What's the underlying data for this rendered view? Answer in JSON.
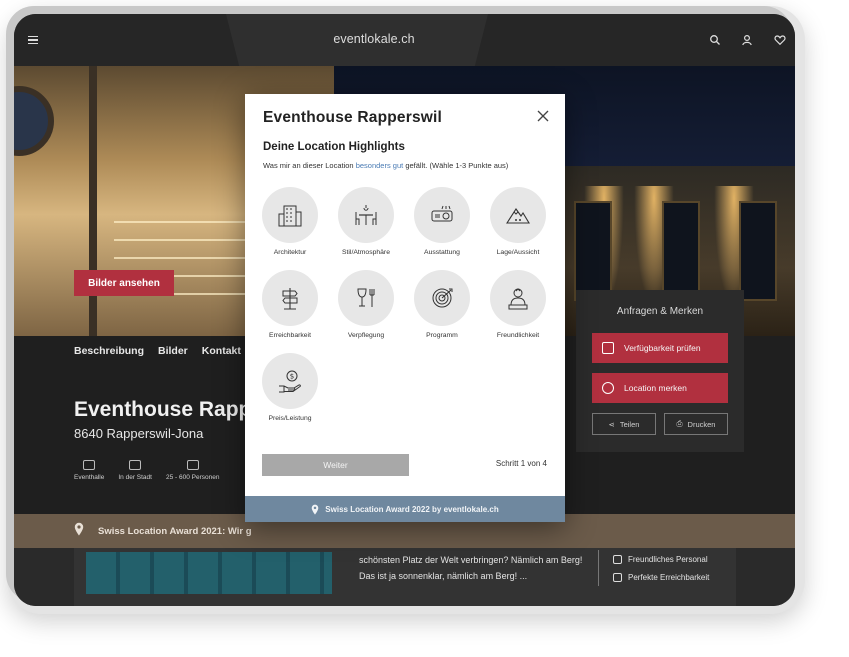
{
  "app": {
    "logo_prefix": "event",
    "logo_suffix": "lokale.ch",
    "icons": [
      "menu-icon",
      "search-icon",
      "user-icon",
      "heart-icon"
    ]
  },
  "hero": {
    "images_button": "Bilder ansehen"
  },
  "subnav": [
    "Beschreibung",
    "Bilder",
    "Kontakt"
  ],
  "venue": {
    "title": "Eventhouse Rapp",
    "location": "8640 Rapperswil-Jona",
    "facts": [
      "Eventhalle",
      "In der Stadt",
      "25 - 600 Personen"
    ]
  },
  "award_band": {
    "text": "Swiss Location Award 2021: Wir g"
  },
  "lower": {
    "text_line1": "schönsten Platz der Welt verbringen? Nämlich am Berg!",
    "text_line2": "Das ist ja sonnenklar, nämlich am Berg! ...",
    "list": [
      "Freundliches Personal",
      "Perfekte Erreichbarkeit"
    ]
  },
  "request_panel": {
    "title": "Anfragen & Merken",
    "availability_button": "Verfügbarkeit prüfen",
    "remember_button": "Location merken",
    "share_button": "Teilen",
    "print_button": "Drucken"
  },
  "modal": {
    "title": "Eventhouse Rapperswil",
    "heading": "Deine Location Highlights",
    "hint_before": "Was mir an dieser Location ",
    "hint_highlight": "besonders gut",
    "hint_after": " gefällt. (Wähle 1-3 Punkte aus)",
    "tiles": [
      {
        "label": "Architektur",
        "icon": "building-icon"
      },
      {
        "label": "Stil/Atmosphäre",
        "icon": "dining-table-icon"
      },
      {
        "label": "Ausstattung",
        "icon": "projector-icon"
      },
      {
        "label": "Lage/Aussicht",
        "icon": "mountain-icon"
      },
      {
        "label": "Erreichbarkeit",
        "icon": "signpost-icon"
      },
      {
        "label": "Verpflegung",
        "icon": "wine-cutlery-icon"
      },
      {
        "label": "Programm",
        "icon": "target-icon"
      },
      {
        "label": "Freundlichkeit",
        "icon": "staff-icon"
      },
      {
        "label": "Preis/Leistung",
        "icon": "money-hand-icon"
      }
    ],
    "next_button": "Weiter",
    "step": "Schritt 1 von 4",
    "footer": "Swiss Location Award 2022 by eventlokale.ch"
  },
  "colors": {
    "accent_red": "#b1303f",
    "footer_blue": "#6f889f",
    "dark_bg": "#1f1f1f"
  }
}
